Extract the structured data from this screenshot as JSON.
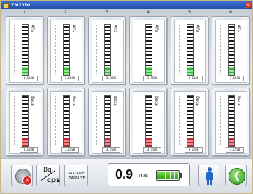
{
  "window": {
    "title": "YM2010",
    "close_glyph": "✕"
  },
  "columns": [
    "1",
    "2",
    "3",
    "4",
    "5",
    "6"
  ],
  "alfa_row": {
    "label": "Alfa",
    "fill_fraction": 0.17,
    "readouts": [
      "3.1580",
      "3.1580",
      "3.1580",
      "3.1580",
      "3.1580",
      "3.1580"
    ]
  },
  "beta_row": {
    "label": "Beta",
    "fill_fraction": 0.17,
    "readouts": [
      "3.1580",
      "3.1580",
      "3.1580",
      "3.1580",
      "3.1580",
      "3.1580"
    ]
  },
  "toolbar": {
    "alarm_icon": "speaker-mute-icon",
    "units": {
      "top": "Bq",
      "bottom": "cps"
    },
    "background": {
      "line1": "POZADIE",
      "line2": "ZAPNUTÉ"
    },
    "speed": {
      "value": "0.9",
      "unit": "m/s"
    },
    "battery_level": 1.0,
    "person_icon": "person-icon",
    "back_icon": "back-arrow-icon",
    "back_glyph": "❮"
  },
  "colors": {
    "alfa_fill": "#2fb52f",
    "beta_fill": "#c8202a",
    "titlebar": "#2a5cc0",
    "accent_blue": "#2466c8",
    "back_green": "#2f9a1a"
  }
}
